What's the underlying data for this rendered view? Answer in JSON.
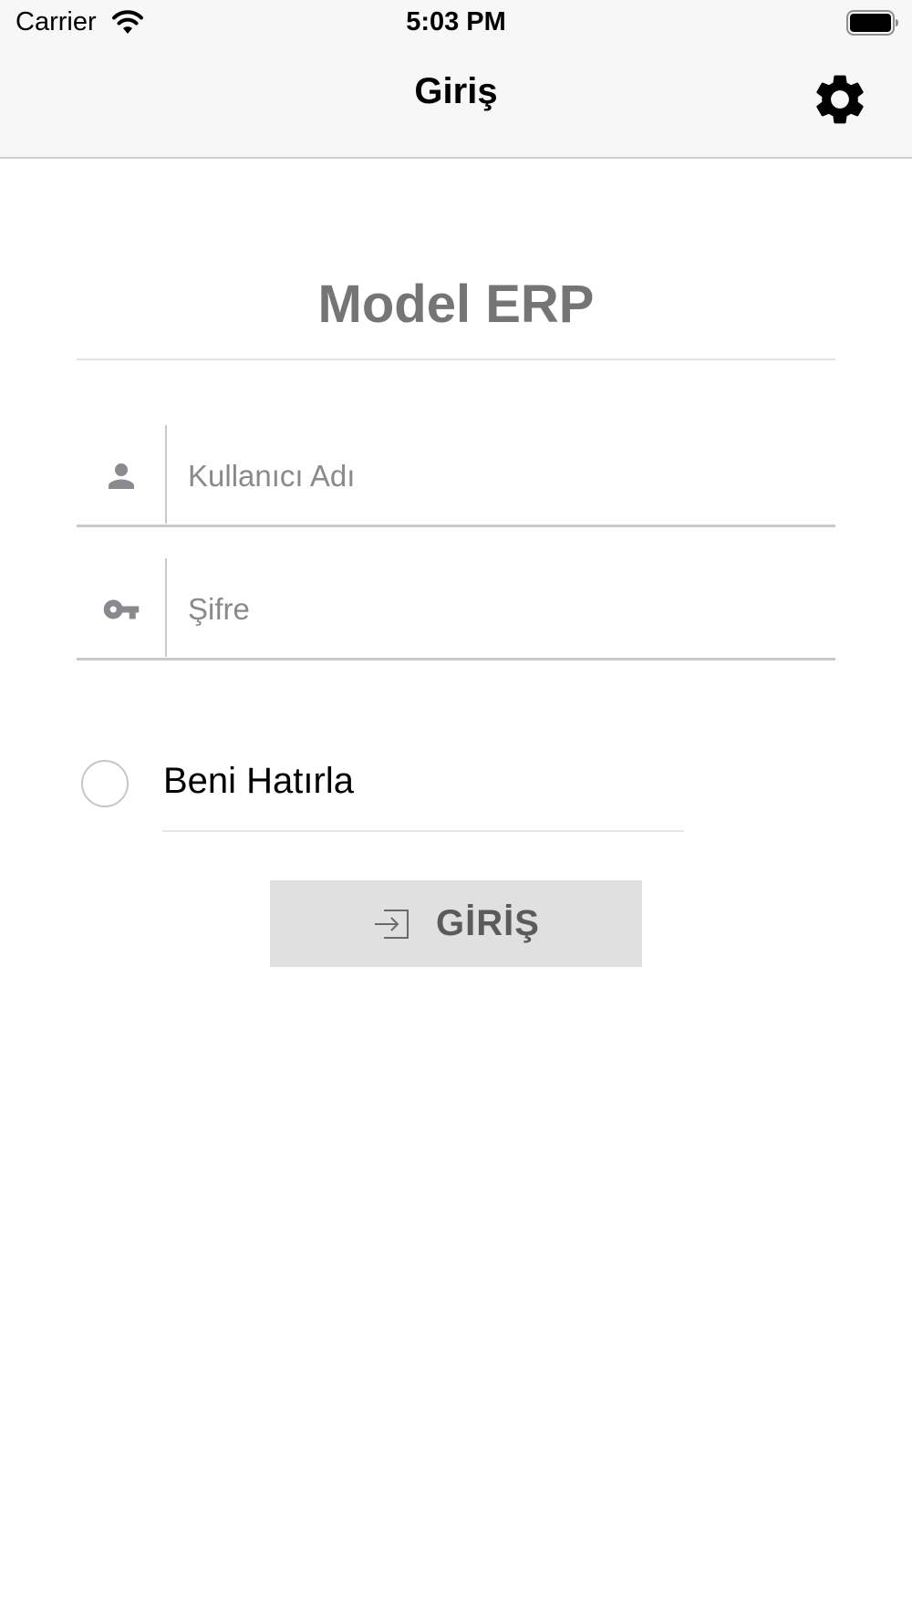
{
  "status_bar": {
    "carrier": "Carrier",
    "time": "5:03 PM",
    "icons": [
      "wifi-icon",
      "battery-icon"
    ]
  },
  "nav_bar": {
    "title": "Giriş",
    "settings_icon": "gear-icon"
  },
  "app": {
    "title": "Model ERP"
  },
  "form": {
    "username": {
      "icon": "person-icon",
      "placeholder": "Kullanıcı Adı",
      "value": ""
    },
    "password": {
      "icon": "key-icon",
      "placeholder": "Şifre",
      "value": ""
    },
    "remember_me": {
      "label": "Beni Hatırla",
      "checked": false
    },
    "login_button": {
      "icon": "login-arrow-icon",
      "label": "GİRİŞ"
    }
  },
  "colors": {
    "nav_background": "#f7f7f7",
    "title_gray": "#757575",
    "button_background": "#e0e0e0",
    "placeholder_gray": "#8a8a8e"
  }
}
